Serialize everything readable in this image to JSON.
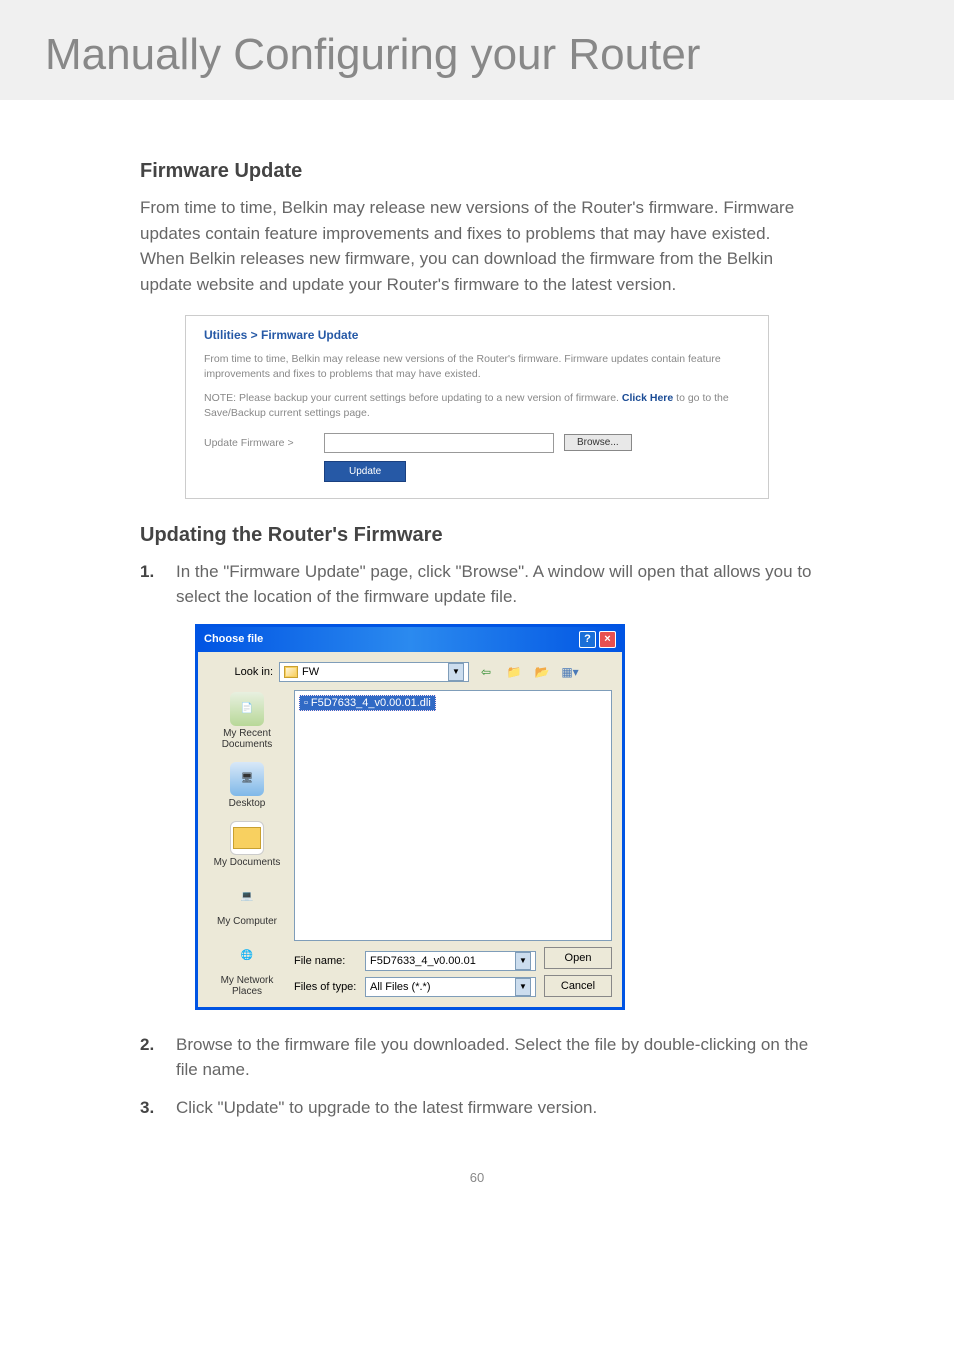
{
  "header": {
    "title": "Manually Configuring your Router"
  },
  "section1": {
    "heading": "Firmware Update",
    "body": "From time to time, Belkin may release new versions of the Router's firmware. Firmware updates contain feature improvements and fixes to problems that may have existed. When Belkin releases new firmware, you can download the firmware from the Belkin update website and update your Router's firmware to the latest version."
  },
  "utilPanel": {
    "title": "Utilities > Firmware Update",
    "desc": "From time to time, Belkin may release new versions of the Router's firmware. Firmware updates contain feature improvements and fixes to problems that may have existed.",
    "notePrefix": "NOTE: Please backup your current settings before updating to a new version of firmware. ",
    "clickHere": "Click Here",
    "noteSuffix": " to go to the Save/Backup current settings page.",
    "fieldLabel": "Update Firmware >",
    "browse": "Browse...",
    "update": "Update"
  },
  "section2": {
    "heading": "Updating the Router's Firmware",
    "steps": [
      {
        "num": "1.",
        "text": "In the \"Firmware Update\" page, click \"Browse\". A window will open that allows you to select the location of the firmware update file."
      },
      {
        "num": "2.",
        "text": "Browse to the firmware file you downloaded. Select the file by double-clicking on the file name."
      },
      {
        "num": "3.",
        "text": "Click \"Update\" to upgrade to the latest firmware version."
      }
    ]
  },
  "dialog": {
    "title": "Choose file",
    "lookInLabel": "Look in:",
    "lookInValue": "FW",
    "selectedFile": "F5D7633_4_v0.00.01.dli",
    "sidebar": [
      "My Recent Documents",
      "Desktop",
      "My Documents",
      "My Computer",
      "My Network Places"
    ],
    "fileNameLabel": "File name:",
    "fileNameValue": "F5D7633_4_v0.00.01",
    "fileTypeLabel": "Files of type:",
    "fileTypeValue": "All Files (*.*)",
    "openBtn": "Open",
    "cancelBtn": "Cancel"
  },
  "pageNumber": "60"
}
